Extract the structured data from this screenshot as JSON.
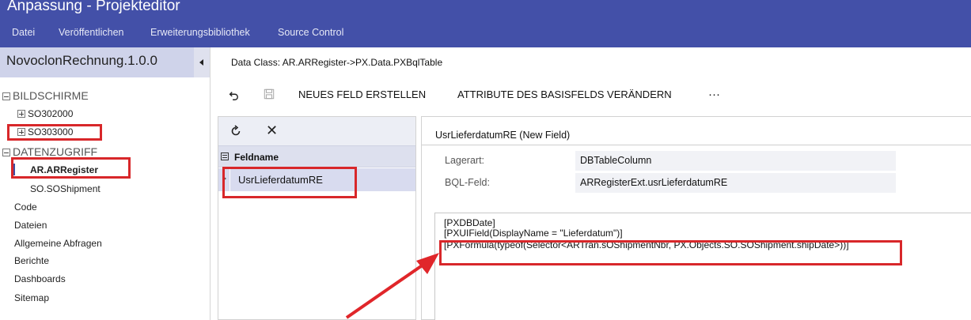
{
  "app": {
    "title": "Anpassung - Projekteditor",
    "menu": [
      "Datei",
      "Veröffentlichen",
      "Erweiterungsbibliothek",
      "Source Control"
    ]
  },
  "sidebar": {
    "project_name": "NovoclonRechnung.1.0.0",
    "sections": {
      "screens": "BILDSCHIRME",
      "data_access": "DATENZUGRIFF"
    },
    "screens": [
      "SO302000",
      "SO303000"
    ],
    "data_access_items": [
      "AR.ARRegister",
      "SO.SOShipment"
    ],
    "other_items": [
      "Code",
      "Dateien",
      "Allgemeine Abfragen",
      "Berichte",
      "Dashboards",
      "Sitemap"
    ]
  },
  "main": {
    "data_class": "Data Class: AR.ARRegister->PX.Data.PXBqlTable",
    "toolbar": {
      "new_field": "NEUES FELD ERSTELLEN",
      "change_attributes": "ATTRIBUTE DES BASISFELDS VERÄNDERN",
      "more": "···"
    },
    "fields_grid": {
      "column_header": "Feldname",
      "rows": [
        "UsrLieferdatumRE"
      ]
    },
    "details": {
      "title": "UsrLieferdatumRE (New Field)",
      "storage_label": "Lagerart:",
      "storage_value": "DBTableColumn",
      "bql_label": "BQL-Feld:",
      "bql_value": "ARRegisterExt.usrLieferdatumRE",
      "code_lines": [
        "[PXDBDate]",
        "[PXUIField(DisplayName = \"Lieferdatum\")]",
        "[PXFormula(typeof(Selector<ARTran.sOShipmentNbr, PX.Objects.SO.SOShipment.shipDate>))]"
      ]
    }
  },
  "colors": {
    "header_bg": "#4350a8",
    "highlight_red": "#d8272a",
    "selection_bg": "#d8dbef"
  }
}
